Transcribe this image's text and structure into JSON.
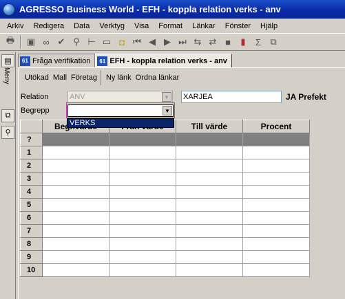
{
  "window": {
    "title": "AGRESSO Business World - EFH - koppla relation verks - anv"
  },
  "menu": [
    "Arkiv",
    "Redigera",
    "Data",
    "Verktyg",
    "Visa",
    "Format",
    "Länkar",
    "Fönster",
    "Hjälp"
  ],
  "toolbar": {
    "icons": [
      "print-icon",
      "save-icon",
      "binoculars-icon",
      "check-icon",
      "search-icon",
      "insert-row-icon",
      "blank-icon",
      "comment-icon",
      "first-icon",
      "prev-icon",
      "next-icon",
      "last-icon",
      "split-icon",
      "merge-icon",
      "gray-box-icon",
      "bar-chart-icon",
      "sum-icon",
      "copy-icon"
    ]
  },
  "sidebar": {
    "menu_label": "Meny"
  },
  "tabs": [
    {
      "icon_text": "61",
      "label": "Fråga verifikation"
    },
    {
      "icon_text": "61",
      "label": "EFH - koppla relation verks - anv"
    }
  ],
  "actions": {
    "group1": [
      "Utökad",
      "Mall",
      "Företag"
    ],
    "group2": [
      "Ny länk",
      "Ordna länkar"
    ]
  },
  "form": {
    "relation_label": "Relation",
    "relation_value": "ANV",
    "relation_text": "XARJEA",
    "relation_desc": "JA Prefekt",
    "begrepp_label": "Begrepp",
    "begrepp_value": "",
    "dropdown_option": "VERKS"
  },
  "grid": {
    "columns": [
      "Begr.värde",
      "Från värde",
      "Till värde",
      "Procent"
    ],
    "new_row_marker": "?",
    "row_numbers": [
      "1",
      "2",
      "3",
      "4",
      "5",
      "6",
      "7",
      "8",
      "9",
      "10"
    ]
  }
}
